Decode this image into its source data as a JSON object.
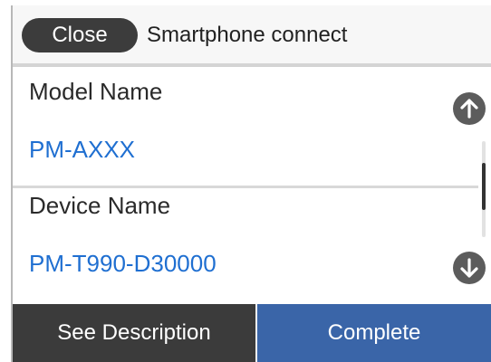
{
  "header": {
    "close_label": "Close",
    "title": "Smartphone connect"
  },
  "details": [
    {
      "label": "Model Name",
      "value": "PM-AXXX"
    },
    {
      "label": "Device Name",
      "value": "PM-T990-D30000"
    }
  ],
  "scroll": {
    "up_icon": "arrow-up-icon",
    "down_icon": "arrow-down-icon"
  },
  "footer": {
    "see_description_label": "See Description",
    "complete_label": "Complete"
  },
  "colors": {
    "value_text": "#1f6fd1",
    "complete_button": "#3a65a8",
    "dark_button": "#3b3b3b"
  }
}
